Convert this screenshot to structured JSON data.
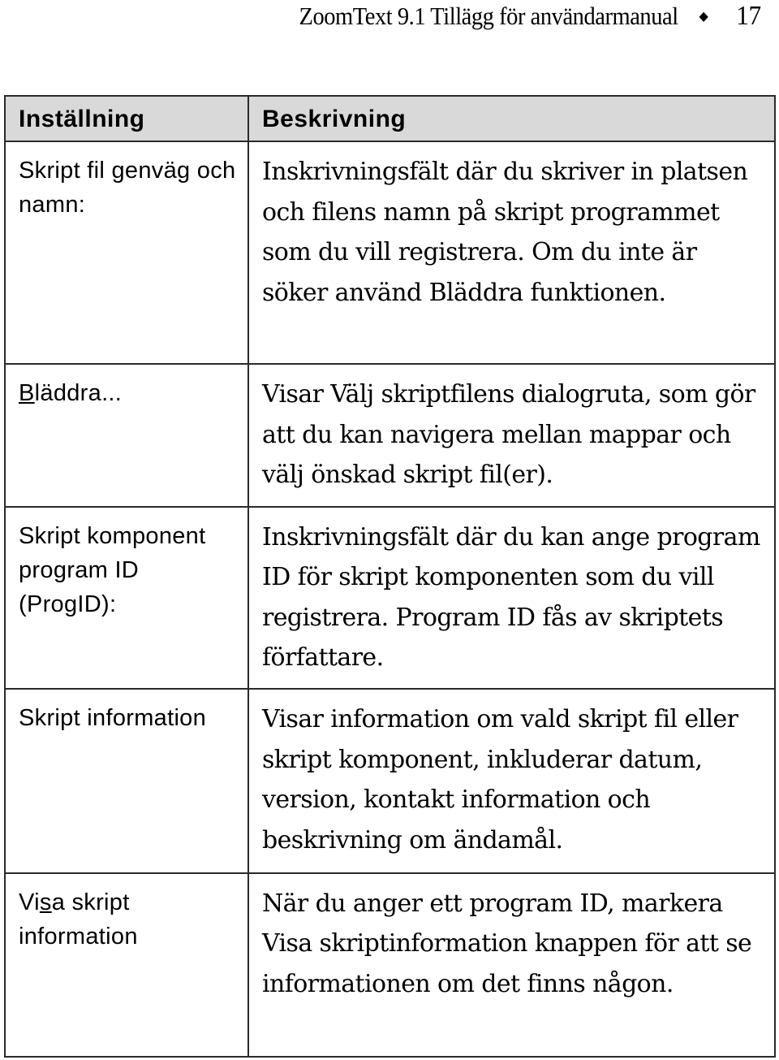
{
  "header": {
    "title": "ZoomText 9.1 Tillägg för användarmanual",
    "separator_icon": "diamond",
    "page_number": "17"
  },
  "table": {
    "columns": [
      "Inställning",
      "Beskrivning"
    ],
    "rows": [
      {
        "setting": "Skript fil genväg och namn:",
        "description": "Inskrivningsfält där du skriver in platsen och filens namn på skript programmet som du vill registrera. Om du inte är söker använd Bläddra funktionen."
      },
      {
        "setting_prefix": "",
        "setting_accel": "B",
        "setting_suffix": "läddra...",
        "description": "Visar Välj skriptfilens dialogruta, som gör att du kan navigera mellan mappar och välj önskad skript fil(er)."
      },
      {
        "setting": "Skript komponent program ID (ProgID):",
        "description": "Inskrivningsfält där du kan ange program ID för skript komponenten som du vill registrera. Program ID fås av skriptets författare."
      },
      {
        "setting": "Skript information",
        "description": "Visar information om vald skript fil eller skript komponent, inkluderar datum, version, kontakt information och beskrivning om ändamål."
      },
      {
        "setting_prefix": "Vi",
        "setting_accel": "s",
        "setting_suffix": "a skript information",
        "description": "När du anger ett program ID, markera Visa skriptinformation knappen för att se informationen om det finns någon."
      }
    ]
  }
}
